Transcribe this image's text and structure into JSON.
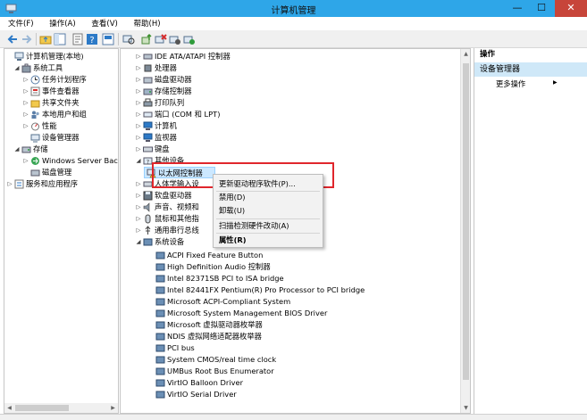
{
  "window": {
    "title": "计算机管理",
    "minimize": "—",
    "maximize": "☐",
    "close": "✕"
  },
  "menu": [
    "文件(F)",
    "操作(A)",
    "查看(V)",
    "帮助(H)"
  ],
  "left_tree": [
    {
      "label": "计算机管理(本地)",
      "exp": ""
    },
    {
      "label": "系统工具",
      "exp": "◢"
    },
    {
      "label": "任务计划程序",
      "exp": "▷"
    },
    {
      "label": "事件查看器",
      "exp": "▷"
    },
    {
      "label": "共享文件夹",
      "exp": "▷"
    },
    {
      "label": "本地用户和组",
      "exp": "▷"
    },
    {
      "label": "性能",
      "exp": "▷"
    },
    {
      "label": "设备管理器",
      "exp": ""
    },
    {
      "label": "存储",
      "exp": "◢"
    },
    {
      "label": "Windows Server Back",
      "exp": "▷"
    },
    {
      "label": "磁盘管理",
      "exp": ""
    },
    {
      "label": "服务和应用程序",
      "exp": "▷"
    }
  ],
  "device_tree": [
    {
      "label": "IDE ATA/ATAPI 控制器",
      "exp": "▷"
    },
    {
      "label": "处理器",
      "exp": "▷"
    },
    {
      "label": "磁盘驱动器",
      "exp": "▷"
    },
    {
      "label": "存储控制器",
      "exp": "▷"
    },
    {
      "label": "打印队列",
      "exp": "▷"
    },
    {
      "label": "端口 (COM 和 LPT)",
      "exp": "▷"
    },
    {
      "label": "计算机",
      "exp": "▷"
    },
    {
      "label": "监视器",
      "exp": "▷"
    },
    {
      "label": "键盘",
      "exp": "▷"
    },
    {
      "label": "其他设备",
      "exp": "◢"
    },
    {
      "label": "以太网控制器",
      "exp": ""
    },
    {
      "label": "人体学输入设",
      "exp": "▷"
    },
    {
      "label": "软盘驱动器",
      "exp": "▷"
    },
    {
      "label": "声音、视频和",
      "exp": "▷"
    },
    {
      "label": "鼠标和其他指",
      "exp": "▷"
    },
    {
      "label": "通用串行总线",
      "exp": "▷"
    },
    {
      "label": "系统设备",
      "exp": "◢"
    },
    {
      "label": "ACPI Fixed Feature Button",
      "exp": ""
    },
    {
      "label": "High Definition Audio 控制器",
      "exp": ""
    },
    {
      "label": "Intel 82371SB PCI to ISA bridge",
      "exp": ""
    },
    {
      "label": "Intel 82441FX Pentium(R) Pro Processor to PCI bridge",
      "exp": ""
    },
    {
      "label": "Microsoft ACPI-Compliant System",
      "exp": ""
    },
    {
      "label": "Microsoft System Management BIOS Driver",
      "exp": ""
    },
    {
      "label": "Microsoft 虚拟驱动器枚举器",
      "exp": ""
    },
    {
      "label": "NDIS 虚拟网络适配器枚举器",
      "exp": ""
    },
    {
      "label": "PCI bus",
      "exp": ""
    },
    {
      "label": "System CMOS/real time clock",
      "exp": ""
    },
    {
      "label": "UMBus Root Bus Enumerator",
      "exp": ""
    },
    {
      "label": "VirtIO Balloon Driver",
      "exp": ""
    },
    {
      "label": "VirtIO Serial Driver",
      "exp": ""
    }
  ],
  "context_menu": {
    "update_driver": "更新驱动程序软件(P)...",
    "disable": "禁用(D)",
    "uninstall": "卸载(U)",
    "scan": "扫描检测硬件改动(A)",
    "properties": "属性(R)"
  },
  "actions": {
    "title": "操作",
    "section": "设备管理器",
    "more": "更多操作",
    "more_arrow": "▶"
  },
  "colors": {
    "titlebar": "#2ea6e8",
    "highlight": "#e0262c",
    "selection": "#cce8ff"
  }
}
